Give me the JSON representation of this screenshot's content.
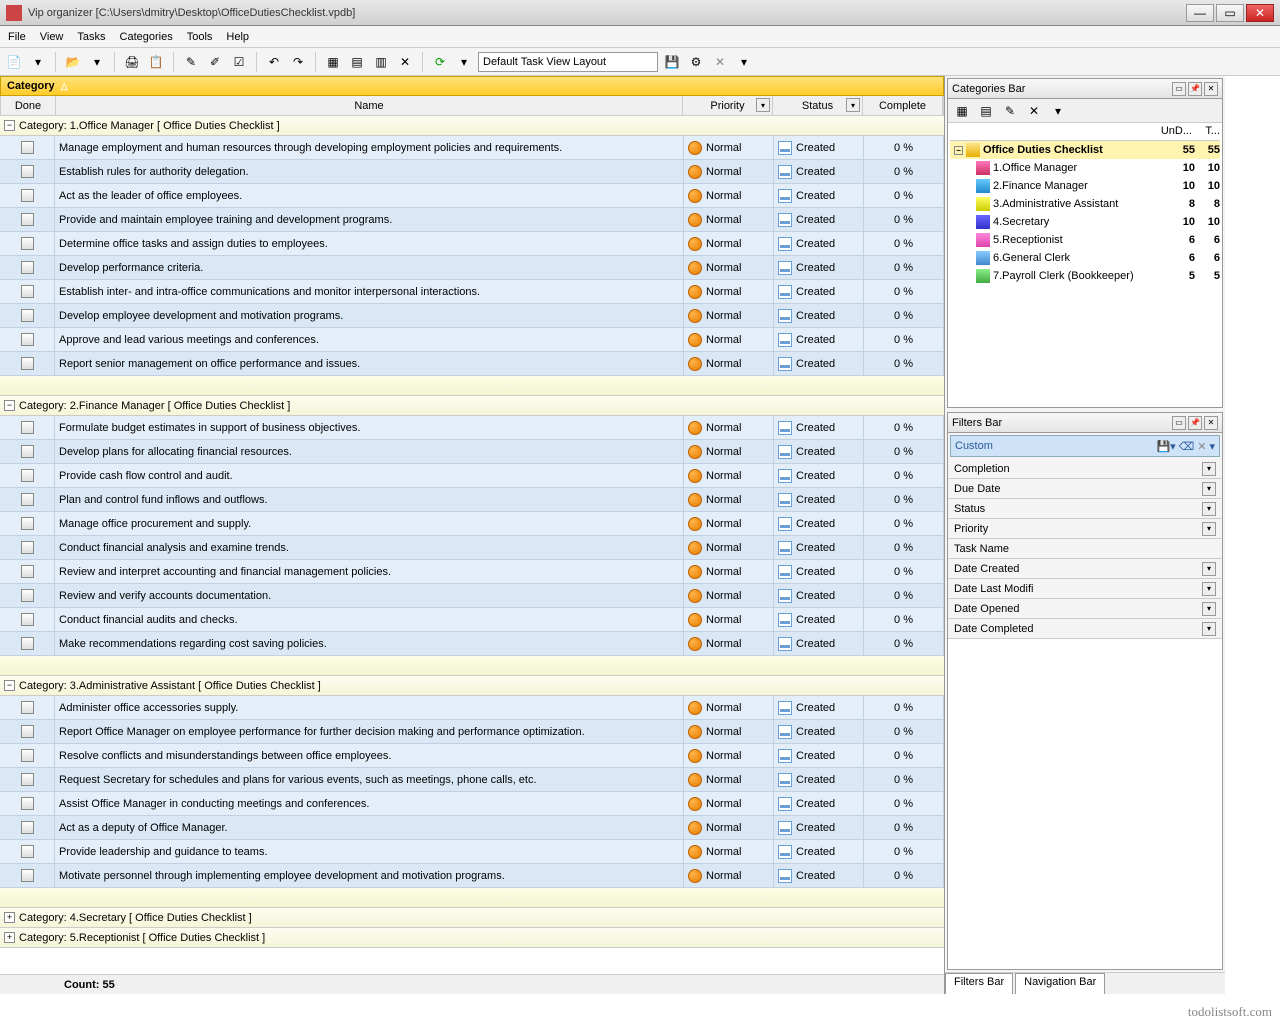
{
  "title": "Vip organizer [C:\\Users\\dmitry\\Desktop\\OfficeDutiesChecklist.vpdb]",
  "menu": [
    "File",
    "View",
    "Tasks",
    "Categories",
    "Tools",
    "Help"
  ],
  "layout_name": "Default Task View Layout",
  "cat_hdr": "Category",
  "cols": {
    "done": "Done",
    "name": "Name",
    "priority": "Priority",
    "status": "Status",
    "complete": "Complete"
  },
  "priority_label": "Normal",
  "status_label": "Created",
  "complete_val": "0 %",
  "footer_count": "Count:  55",
  "groups": [
    {
      "name": "Category: 1.Office Manager   [ Office Duties Checklist ]",
      "open": true,
      "tasks": [
        "Manage employment and human resources through developing employment policies and requirements.",
        "Establish rules for authority delegation.",
        "Act as the leader of office employees.",
        "Provide and maintain employee training and development programs.",
        "Determine office tasks and assign duties to employees.",
        "Develop performance criteria.",
        "Establish inter- and intra-office communications and monitor interpersonal interactions.",
        "Develop employee development and motivation programs.",
        "Approve and lead various meetings and conferences.",
        "Report senior management on office performance and issues."
      ]
    },
    {
      "name": "Category: 2.Finance Manager   [ Office Duties Checklist ]",
      "open": true,
      "tasks": [
        "Formulate budget estimates in support of business objectives.",
        "Develop plans for allocating financial resources.",
        "Provide cash flow control and audit.",
        "Plan and control fund inflows and outflows.",
        "Manage office procurement and supply.",
        "Conduct financial analysis and examine trends.",
        "Review and interpret accounting and financial management policies.",
        "Review and verify accounts documentation.",
        "Conduct financial audits and checks.",
        "Make recommendations regarding cost saving policies."
      ]
    },
    {
      "name": "Category: 3.Administrative Assistant   [ Office Duties Checklist ]",
      "open": true,
      "tasks": [
        "Administer office accessories supply.",
        "Report Office Manager on employee performance for further decision making and performance optimization.",
        "Resolve conflicts and misunderstandings between office employees.",
        "Request Secretary for schedules and plans for various events, such as meetings, phone calls, etc.",
        "Assist Office Manager in conducting meetings and conferences.",
        "Act as a deputy of Office Manager.",
        "Provide leadership and guidance to teams.",
        "Motivate personnel through implementing employee development and motivation programs."
      ]
    },
    {
      "name": "Category: 4.Secretary   [ Office Duties Checklist ]",
      "open": false,
      "tasks": []
    },
    {
      "name": "Category: 5.Receptionist   [ Office Duties Checklist ]",
      "open": false,
      "tasks": []
    }
  ],
  "cat_panel": {
    "title": "Categories Bar",
    "hdr1": "UnD...",
    "hdr2": "T...",
    "root": {
      "label": "Office Duties Checklist",
      "n1": "55",
      "n2": "55",
      "ico": "ico-folder"
    },
    "nodes": [
      {
        "label": "1.Office Manager",
        "n1": "10",
        "n2": "10",
        "ico": "ico-person"
      },
      {
        "label": "2.Finance Manager",
        "n1": "10",
        "n2": "10",
        "ico": "ico-book"
      },
      {
        "label": "3.Administrative Assistant",
        "n1": "8",
        "n2": "8",
        "ico": "ico-key"
      },
      {
        "label": "4.Secretary",
        "n1": "10",
        "n2": "10",
        "ico": "ico-flag"
      },
      {
        "label": "5.Receptionist",
        "n1": "6",
        "n2": "6",
        "ico": "ico-pink"
      },
      {
        "label": "6.General Clerk",
        "n1": "6",
        "n2": "6",
        "ico": "ico-globe"
      },
      {
        "label": "7.Payroll Clerk (Bookkeeper)",
        "n1": "5",
        "n2": "5",
        "ico": "ico-green"
      }
    ]
  },
  "filter_panel": {
    "title": "Filters Bar",
    "custom": "Custom",
    "rows": [
      "Completion",
      "Due Date",
      "Status",
      "Priority",
      "Task Name",
      "Date Created",
      "Date Last Modifi",
      "Date Opened",
      "Date Completed"
    ]
  },
  "bottom_tabs": [
    "Filters Bar",
    "Navigation Bar"
  ],
  "watermark": "todolistsoft.com"
}
